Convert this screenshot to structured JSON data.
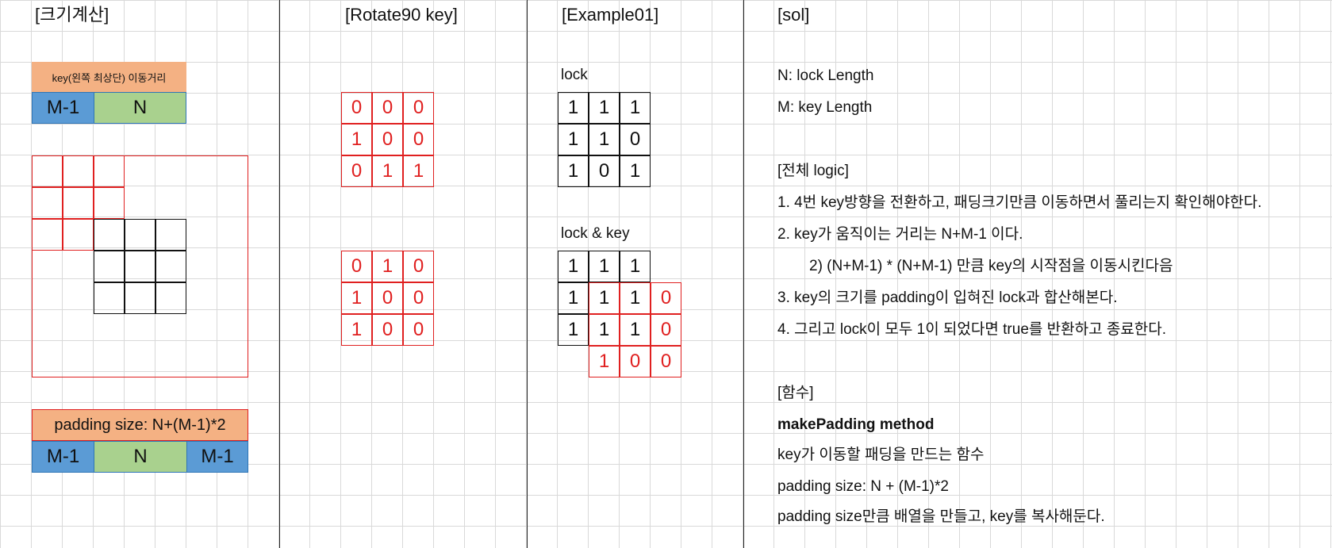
{
  "headers": {
    "size_calc": "[크기계산]",
    "rotate": "[Rotate90 key]",
    "example": "[Example01]",
    "sol": "[sol]"
  },
  "size_calc": {
    "key_move_label": "key(왼쪽 최상단) 이동거리",
    "top_segments": [
      "M-1",
      "N"
    ],
    "padding_label": "padding size: N+(M-1)*2",
    "bottom_segments": [
      "M-1",
      "N",
      "M-1"
    ]
  },
  "rotate": {
    "matrix1": [
      [
        "0",
        "0",
        "0"
      ],
      [
        "1",
        "0",
        "0"
      ],
      [
        "0",
        "1",
        "1"
      ]
    ],
    "matrix2": [
      [
        "0",
        "1",
        "0"
      ],
      [
        "1",
        "0",
        "0"
      ],
      [
        "1",
        "0",
        "0"
      ]
    ]
  },
  "example": {
    "lock_label": "lock",
    "lock_matrix": [
      [
        "1",
        "1",
        "1"
      ],
      [
        "1",
        "1",
        "0"
      ],
      [
        "1",
        "0",
        "1"
      ]
    ],
    "lock_key_label": "lock & key",
    "lk_lock": [
      [
        "1",
        "1",
        "1"
      ],
      [
        "1",
        "",
        ""
      ],
      [
        "1",
        "",
        ""
      ]
    ],
    "lk_key": [
      [
        "1",
        "1",
        "0"
      ],
      [
        "1",
        "1",
        "0"
      ],
      [
        "1",
        "0",
        "0"
      ]
    ]
  },
  "sol": {
    "lines": [
      "N: lock Length",
      "M: key Length",
      "",
      "[전체 logic]",
      "1. 4번 key방향을 전환하고, 패딩크기만큼 이동하면서 풀리는지 확인해야한다.",
      "2. key가 움직이는 거리는 N+M-1 이다.",
      "2) (N+M-1) * (N+M-1) 만큼 key의 시작점을 이동시킨다음",
      "3. key의 크기를 padding이 입혀진 lock과 합산해본다.",
      "4. 그리고 lock이 모두 1이 되었다면 true를 반환하고 종료한다.",
      "",
      "[함수]",
      "makePadding method",
      "key가 이동할 패딩을 만드는 함수",
      "padding size: N + (M-1)*2",
      "padding size만큼 배열을 만들고, key를 복사해둔다."
    ]
  },
  "colors": {
    "orange": "#f4b183",
    "blue": "#5b9bd5",
    "green": "#a9d18e",
    "red": "#e02020"
  }
}
